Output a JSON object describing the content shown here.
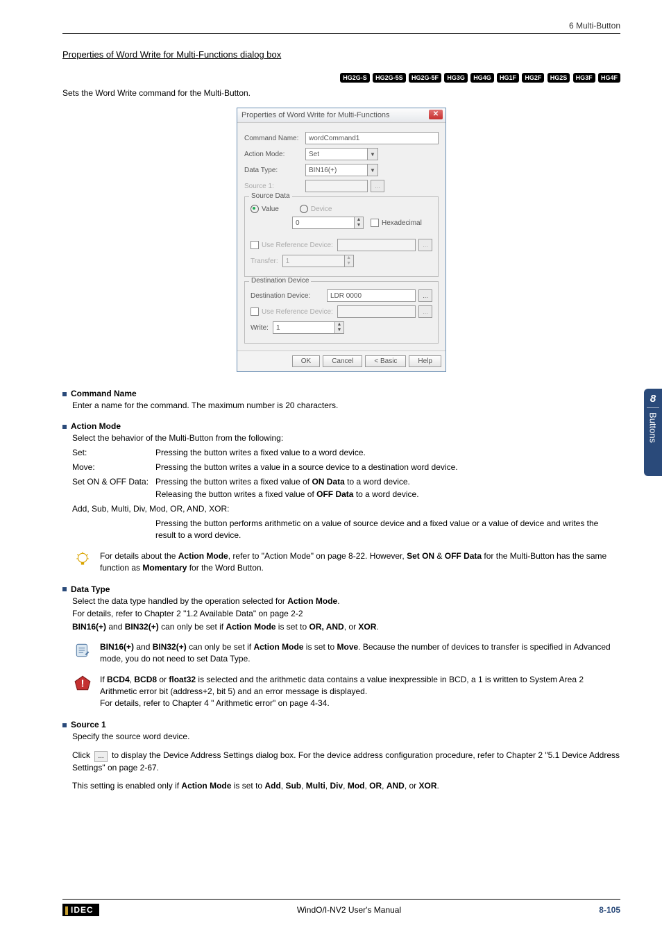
{
  "header": {
    "breadcrumb": "6 Multi-Button"
  },
  "section_title": "Properties of Word Write for Multi-Functions dialog box",
  "badges": [
    "HG2G-S",
    "HG2G-5S",
    "HG2G-5F",
    "HG3G",
    "HG4G",
    "HG1F",
    "HG2F",
    "HG2S",
    "HG3F",
    "HG4F"
  ],
  "intro": "Sets the Word Write command for the Multi-Button.",
  "dialog": {
    "title": "Properties of Word Write for Multi-Functions",
    "command_name_label": "Command Name:",
    "command_name_value": "wordCommand1",
    "action_mode_label": "Action Mode:",
    "action_mode_value": "Set",
    "data_type_label": "Data Type:",
    "data_type_value": "BIN16(+)",
    "source1_label": "Source 1:",
    "source_data_legend": "Source Data",
    "radio_value": "Value",
    "radio_device": "Device",
    "value_input": "0",
    "hex_label": "Hexadecimal",
    "use_ref_label": "Use Reference Device:",
    "transfer_label": "Transfer:",
    "transfer_value": "1",
    "dest_legend": "Destination Device",
    "dest_device_label": "Destination Device:",
    "dest_device_value": "LDR 0000",
    "dest_use_ref_label": "Use Reference Device:",
    "write_label": "Write:",
    "write_value": "1",
    "btn_ok": "OK",
    "btn_cancel": "Cancel",
    "btn_basic": "< Basic",
    "btn_help": "Help"
  },
  "cmd_name": {
    "title": "Command Name",
    "text": "Enter a name for the command. The maximum number is 20 characters."
  },
  "action_mode": {
    "title": "Action Mode",
    "lead": "Select the behavior of the Multi-Button from the following:",
    "rows": {
      "set_term": "Set:",
      "set_desc": "Pressing the button writes a fixed value to a word device.",
      "move_term": "Move:",
      "move_desc": "Pressing the button writes a value in a source device to a destination word device.",
      "setonoff_term": "Set ON & OFF Data:",
      "setonoff_l1a": "Pressing the button writes a fixed value of ",
      "setonoff_l1b": "ON Data",
      "setonoff_l1c": " to a word device.",
      "setonoff_l2a": "Releasing the button writes a fixed value of ",
      "setonoff_l2b": "OFF Data",
      "setonoff_l2c": " to a word device.",
      "math_term": "Add, Sub, Multi, Div, Mod, OR, AND, XOR:",
      "math_desc": "Pressing the button performs arithmetic on a value of source device and a fixed value or a value of device and writes the result to a word device."
    },
    "note_a": "For details about the ",
    "note_b": "Action Mode",
    "note_c": ", refer to \"Action Mode\" on page 8-22. However, ",
    "note_d": "Set ON",
    "note_e": " & ",
    "note_f": "OFF Data",
    "note_g": " for the Multi-Button has the same function as ",
    "note_h": "Momentary",
    "note_i": " for the Word Button."
  },
  "data_type": {
    "title": "Data Type",
    "l1a": "Select the data type handled by the operation selected for ",
    "l1b": "Action Mode",
    "l1c": ".",
    "l2": "For details, refer to Chapter 2 \"1.2 Available Data\" on page 2-2",
    "l3a": "BIN16(+)",
    "l3b": " and ",
    "l3c": "BIN32(+)",
    "l3d": " can only be set if ",
    "l3e": "Action Mode",
    "l3f": " is set to ",
    "l3g": "OR, AND",
    "l3h": ", or ",
    "l3i": "XOR",
    "l3j": ".",
    "note1_a": "BIN16(+)",
    "note1_b": " and ",
    "note1_c": "BIN32(+)",
    "note1_d": " can only be set if ",
    "note1_e": "Action Mode",
    "note1_f": " is set to ",
    "note1_g": "Move",
    "note1_h": ". Because the number of devices to transfer is specified in Advanced mode, you do not need to set Data Type.",
    "note2_a": "If ",
    "note2_b": "BCD4",
    "note2_c": ", ",
    "note2_d": "BCD8",
    "note2_e": " or ",
    "note2_f": "float32",
    "note2_g": " is selected and the arithmetic data contains a value inexpressible in BCD, a 1 is written to System Area 2 Arithmetic error bit (address+2, bit 5) and an error message is displayed.",
    "note2_h": "For details, refer to Chapter 4 \" Arithmetic error\" on page 4-34."
  },
  "source1": {
    "title": "Source 1",
    "l1": "Specify the source word device.",
    "l2a": "Click ",
    "l2b": "...",
    "l2c": " to display the Device Address Settings dialog box. For the device address configuration procedure, refer to Chapter 2 \"5.1 Device Address Settings\" on page 2-67.",
    "l3a": "This setting is enabled only if ",
    "l3b": "Action Mode",
    "l3c": " is set to ",
    "l3d": "Add",
    "l3e": "Sub",
    "l3f": "Multi",
    "l3g": "Div",
    "l3h": "Mod",
    "l3i": "OR",
    "l3j": "AND",
    "l3k": "XOR",
    "comma": ", ",
    "or": ", or ",
    "period": "."
  },
  "side": {
    "num": "8",
    "label": "Buttons"
  },
  "footer": {
    "manual": "WindO/I-NV2 User's Manual",
    "page": "8-105",
    "brand": "IDEC"
  }
}
